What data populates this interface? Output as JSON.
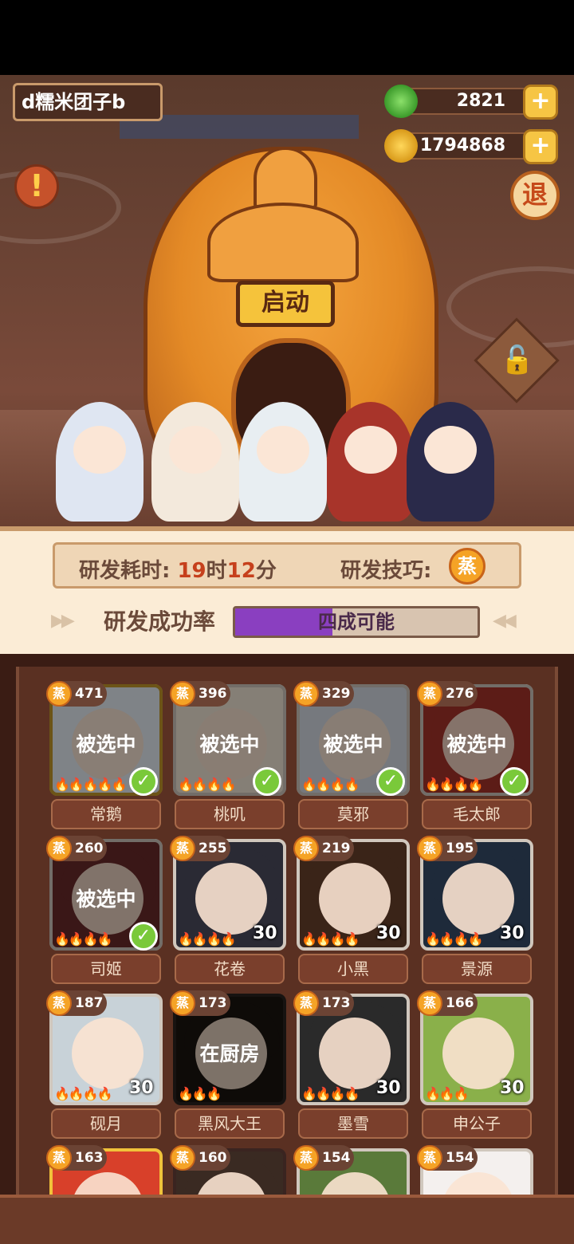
{
  "player": {
    "name": "d糯米团子b"
  },
  "resources": {
    "jade": {
      "value": "2821",
      "plus": "+"
    },
    "coins": {
      "value": "1794868",
      "plus": "+"
    }
  },
  "buttons": {
    "warning": "!",
    "exit": "退",
    "start": "启动",
    "lock": "🔓"
  },
  "research": {
    "time_label": "研发耗时:",
    "time_hours": "19",
    "time_h_unit": "时",
    "time_minutes": "12",
    "time_m_unit": "分",
    "skill_label": "研发技巧:",
    "skill_badge": "蒸",
    "success_label": "研发成功率",
    "success_text": "四成可能",
    "success_fraction": 0.4
  },
  "colors": {
    "accent": "#f5a326",
    "progress": "#8a3fc0",
    "check": "#7ac93a"
  },
  "cards": [
    {
      "badge": "蒸",
      "power": "471",
      "name": "常鹅",
      "state": "被选中",
      "selected": true,
      "level": "",
      "flames": "🔥🔥🔥🔥🔥",
      "hair": "#e8eef6",
      "frame": "#c59a2a"
    },
    {
      "badge": "蒸",
      "power": "396",
      "name": "桃叽",
      "state": "被选中",
      "selected": true,
      "level": "",
      "flames": "🔥🔥🔥🔥",
      "hair": "#f3e7d8",
      "frame": "#d0c7bd"
    },
    {
      "badge": "蒸",
      "power": "329",
      "name": "莫邪",
      "state": "被选中",
      "selected": true,
      "level": "",
      "flames": "🔥🔥🔥🔥",
      "hair": "#d8dde6",
      "frame": "#d0c7bd"
    },
    {
      "badge": "蒸",
      "power": "276",
      "name": "毛太郎",
      "state": "被选中",
      "selected": true,
      "level": "",
      "flames": "🔥🔥🔥🔥",
      "hair": "#a8342a",
      "frame": "#d0c7bd"
    },
    {
      "badge": "蒸",
      "power": "260",
      "name": "司姬",
      "state": "被选中",
      "selected": true,
      "level": "",
      "flames": "🔥🔥🔥🔥",
      "hair": "#6a2a2a",
      "frame": "#d0c7bd"
    },
    {
      "badge": "蒸",
      "power": "255",
      "name": "花卷",
      "state": "",
      "selected": false,
      "level": "30",
      "flames": "🔥🔥🔥🔥",
      "hair": "#2a2a34",
      "frame": "#d0c7bd"
    },
    {
      "badge": "蒸",
      "power": "219",
      "name": "小黑",
      "state": "",
      "selected": false,
      "level": "30",
      "flames": "🔥🔥🔥🔥",
      "hair": "#3a2418",
      "frame": "#d0c7bd"
    },
    {
      "badge": "蒸",
      "power": "195",
      "name": "景源",
      "state": "",
      "selected": false,
      "level": "30",
      "flames": "🔥🔥🔥🔥",
      "hair": "#1e2a3a",
      "frame": "#d0c7bd"
    },
    {
      "badge": "蒸",
      "power": "187",
      "name": "砚月",
      "state": "",
      "selected": false,
      "level": "30",
      "flames": "🔥🔥🔥🔥",
      "hair": "#c8d2d8",
      "frame": "#d0c7bd"
    },
    {
      "badge": "蒸",
      "power": "173",
      "name": "黑风大王",
      "state": "在厨房",
      "selected": false,
      "level": "",
      "flames": "🔥🔥🔥",
      "hair": "#1a1410",
      "frame": "#2a2420"
    },
    {
      "badge": "蒸",
      "power": "173",
      "name": "墨雪",
      "state": "",
      "selected": false,
      "level": "30",
      "flames": "🔥🔥🔥🔥",
      "hair": "#2a2a2a",
      "frame": "#d0c7bd"
    },
    {
      "badge": "蒸",
      "power": "166",
      "name": "申公子",
      "state": "",
      "selected": false,
      "level": "30",
      "flames": "🔥🔥🔥",
      "hair": "#8ab04a",
      "frame": "#d0c7bd"
    },
    {
      "badge": "蒸",
      "power": "163",
      "name": "",
      "state": "",
      "selected": false,
      "level": "",
      "flames": "",
      "hair": "#d8402a",
      "frame": "#f1c23a"
    },
    {
      "badge": "蒸",
      "power": "160",
      "name": "",
      "state": "",
      "selected": false,
      "level": "",
      "flames": "",
      "hair": "#3a2a22",
      "frame": "#3a2420"
    },
    {
      "badge": "蒸",
      "power": "154",
      "name": "",
      "state": "",
      "selected": false,
      "level": "",
      "flames": "",
      "hair": "#5a7a3a",
      "frame": "#d0c7bd"
    },
    {
      "badge": "蒸",
      "power": "154",
      "name": "",
      "state": "",
      "selected": false,
      "level": "",
      "flames": "",
      "hair": "#f4f0ee",
      "frame": "#d0c7bd"
    }
  ]
}
